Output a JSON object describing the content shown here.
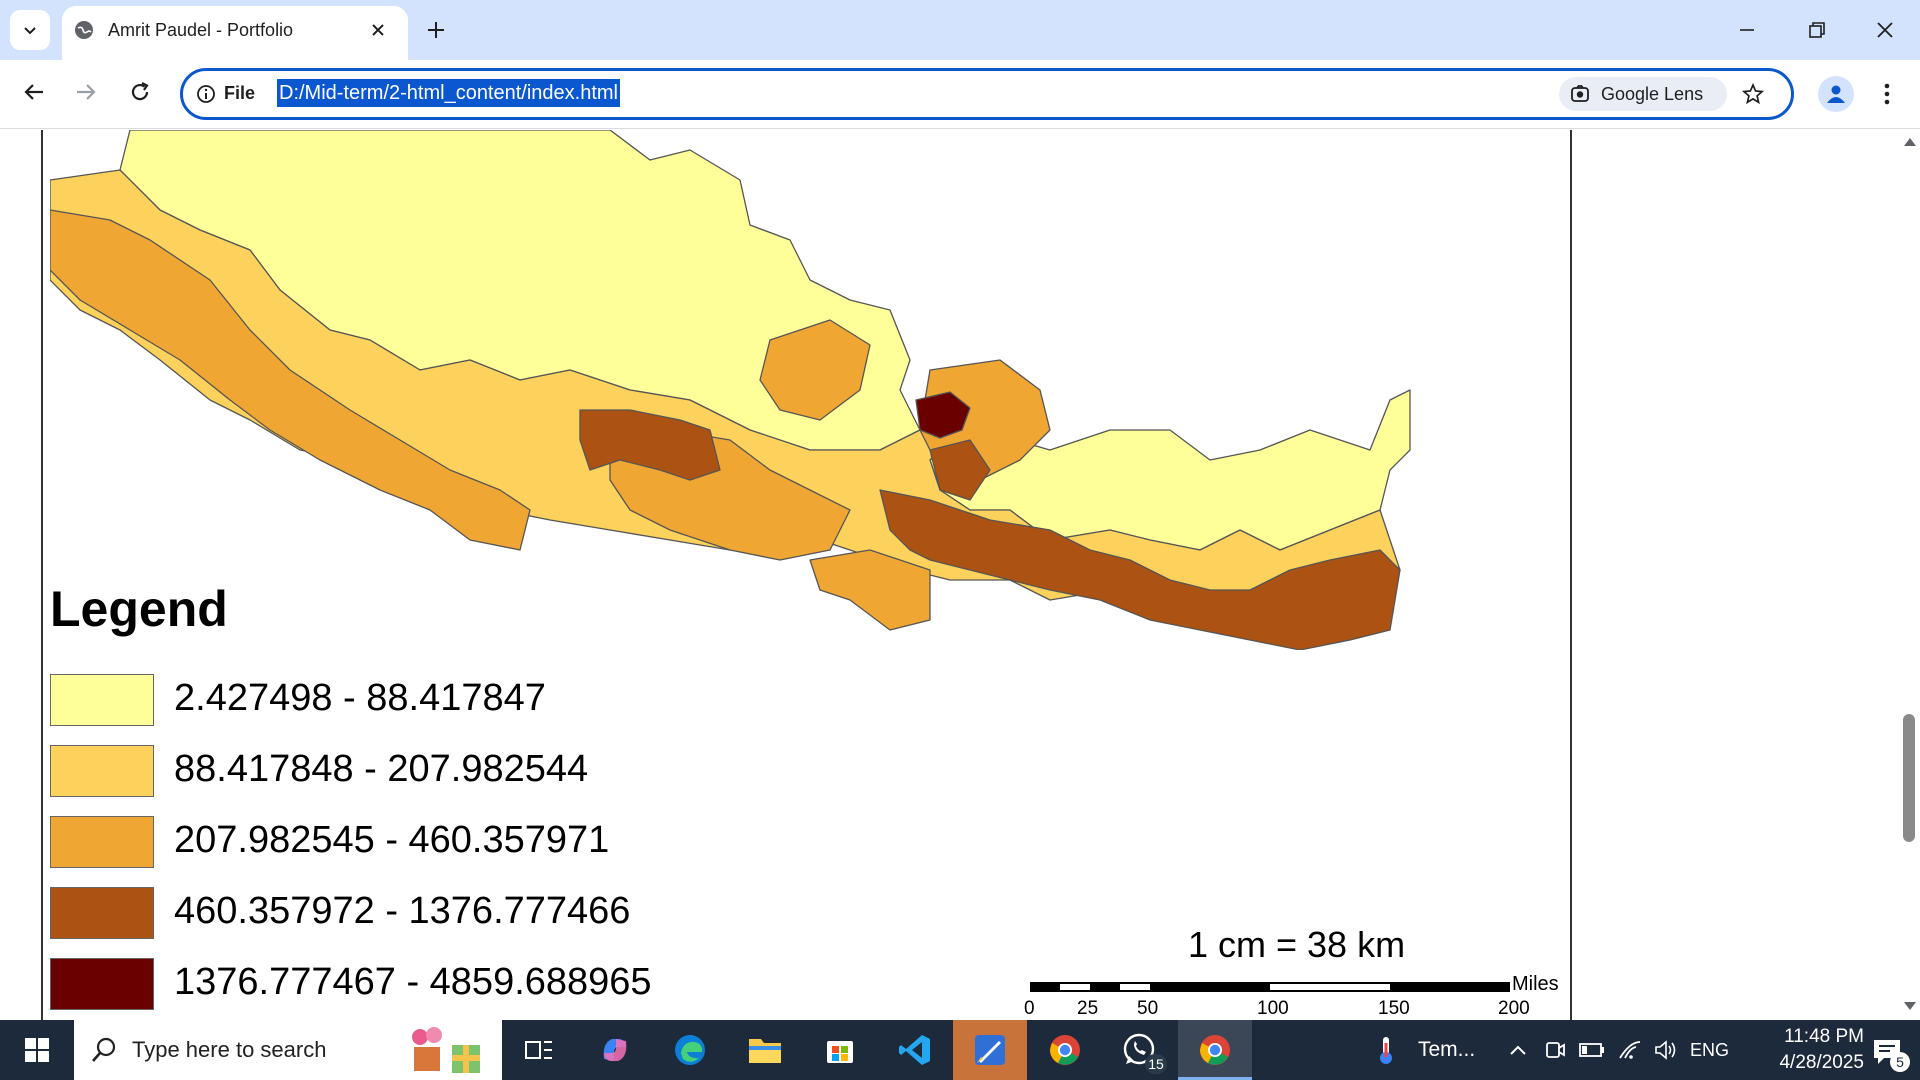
{
  "browser": {
    "tab_title": "Amrit Paudel - Portfolio",
    "site_info_label": "File",
    "url": "D:/Mid-term/2-html_content/index.html",
    "lens_label": "Google Lens"
  },
  "map": {
    "legend_title": "Legend",
    "legend": [
      {
        "label": "2.427498 - 88.417847",
        "color": "#ffff99"
      },
      {
        "label": "88.417848 - 207.982544",
        "color": "#fcd25c"
      },
      {
        "label": "207.982545 - 460.357971",
        "color": "#f0a633"
      },
      {
        "label": "460.357972 - 1376.777466",
        "color": "#ac5213"
      },
      {
        "label": "1376.777467 - 4859.688965",
        "color": "#6b0000"
      }
    ],
    "scale_text": "1 cm = 38 km",
    "scale_unit": "Miles",
    "scale_ticks": [
      "0",
      "25",
      "50",
      "100",
      "150",
      "200"
    ]
  },
  "taskbar": {
    "search_placeholder": "Type here to search",
    "weather_label": "Tem...",
    "language": "ENG",
    "time": "11:48 PM",
    "date": "4/28/2025",
    "whatsapp_badge": "15",
    "notification_count": "5"
  },
  "colors": {
    "accent": "#0b57d0",
    "tabbar": "#d3e3fd",
    "taskbar": "#1c2a3b"
  }
}
